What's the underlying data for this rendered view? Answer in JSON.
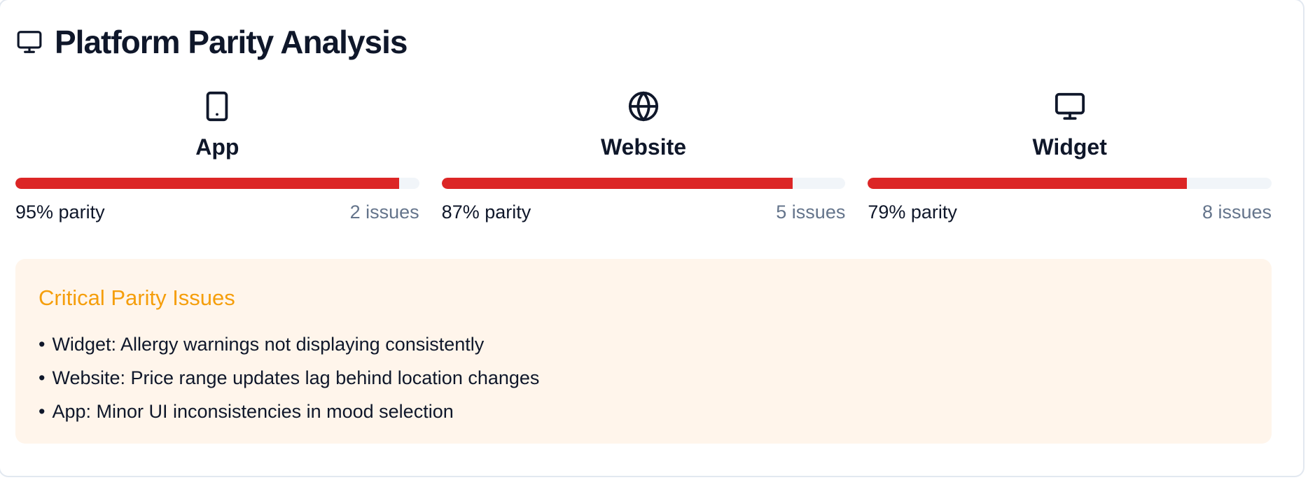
{
  "header": {
    "title": "Platform Parity Analysis",
    "icon": "monitor-icon"
  },
  "platforms": [
    {
      "name": "App",
      "icon": "smartphone-icon",
      "parity_percent": 95,
      "parity_label": "95% parity",
      "issues_label": "2 issues"
    },
    {
      "name": "Website",
      "icon": "globe-icon",
      "parity_percent": 87,
      "parity_label": "87% parity",
      "issues_label": "5 issues"
    },
    {
      "name": "Widget",
      "icon": "monitor-icon",
      "parity_percent": 79,
      "parity_label": "79% parity",
      "issues_label": "8 issues"
    }
  ],
  "critical": {
    "title": "Critical Parity Issues",
    "bullet": "•",
    "items": [
      "Widget: Allergy warnings not displaying consistently",
      "Website: Price range updates lag behind location changes",
      "App: Minor UI inconsistencies in mood selection"
    ]
  },
  "colors": {
    "bar_fill": "#dc2626",
    "bar_track": "#f1f5f9",
    "critical_title": "#f59e0b",
    "critical_bg": "#fff5eb",
    "muted_text": "#64748b"
  }
}
